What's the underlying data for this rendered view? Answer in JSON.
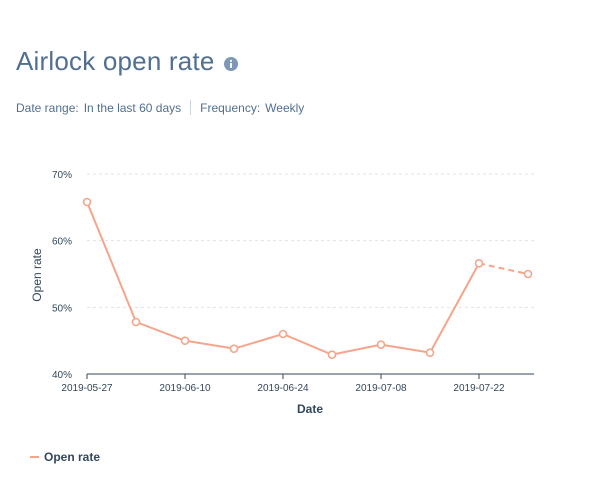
{
  "header": {
    "title": "Airlock open rate",
    "info_icon": "info-circle-icon"
  },
  "filters": {
    "date_range_label": "Date range:",
    "date_range_value": "In the last 60 days",
    "frequency_label": "Frequency:",
    "frequency_value": "Weekly"
  },
  "colors": {
    "series": "#f5a58c",
    "grid": "#dfe3eb",
    "axis": "#33475b",
    "tick_text": "#33475b",
    "title_text": "#516f90",
    "info_icon": "#7c98b6"
  },
  "chart_data": {
    "type": "line",
    "xlabel": "Date",
    "ylabel": "Open rate",
    "ylim": [
      40,
      70
    ],
    "yticks": [
      40,
      50,
      60,
      70
    ],
    "ytick_labels": [
      "40%",
      "50%",
      "60%",
      "70%"
    ],
    "xticks": [
      "2019-05-27",
      "2019-06-10",
      "2019-06-24",
      "2019-07-08",
      "2019-07-22"
    ],
    "x": [
      "2019-05-27",
      "2019-06-03",
      "2019-06-10",
      "2019-06-17",
      "2019-06-24",
      "2019-07-01",
      "2019-07-08",
      "2019-07-15",
      "2019-07-22",
      "2019-07-29"
    ],
    "grid": true,
    "legend_position": "bottom-left",
    "series": [
      {
        "name": "Open rate",
        "values": [
          65.8,
          47.8,
          45.0,
          43.8,
          46.0,
          42.9,
          44.4,
          43.2,
          56.6,
          55.0
        ],
        "dashed_last_segment": true
      }
    ]
  }
}
